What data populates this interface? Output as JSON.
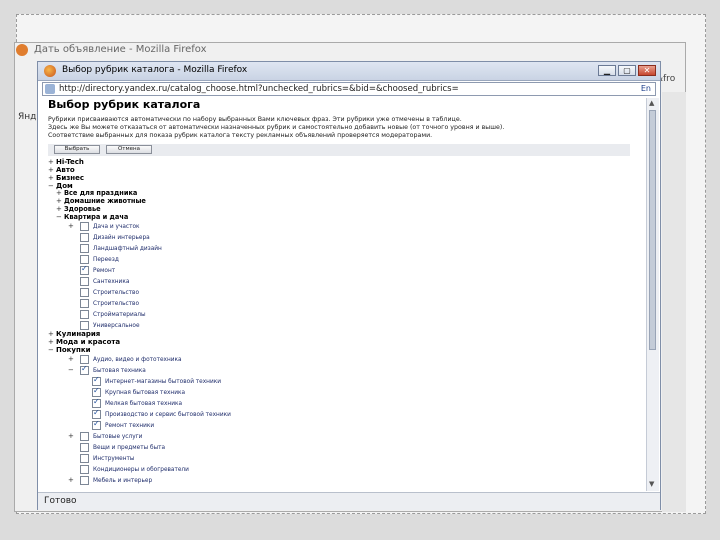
{
  "background_window": {
    "title": "Дать объявление - Mozilla Firefox",
    "right_text": "&fro",
    "left_glyphs": [
      "Янд"
    ]
  },
  "window": {
    "title": "Выбор рубрик каталога - Mozilla Firefox",
    "url": "http://directory.yandex.ru/catalog_choose.html?unchecked_rubrics=&bid=&choosed_rubrics=",
    "lang_indicator": "En",
    "status": "Готово"
  },
  "page": {
    "heading": "Выбор рубрик каталога",
    "intro_lines": [
      "Рубрики присваиваются автоматически по набору выбранных Вами ключевых фраз. Эти рубрики уже отмечены в таблице.",
      "Здесь же Вы можете отказаться от автоматически назначенных рубрик и самостоятельно добавить новые (от точного уровня и выше).",
      "Соответствие выбранных для показа рубрик каталога тексту рекламных объявлений проверяется модераторами."
    ],
    "buttons": {
      "choose": "Выбрать",
      "cancel": "Отмена"
    }
  },
  "tree": {
    "top1": [
      {
        "pm": "+",
        "label": "Hi-Tech"
      },
      {
        "pm": "+",
        "label": "Авто"
      },
      {
        "pm": "+",
        "label": "Бизнес"
      },
      {
        "pm": "−",
        "label": "Дом"
      }
    ],
    "dom_children": [
      {
        "pm": "+",
        "label": "Все для праздника"
      },
      {
        "pm": "+",
        "label": "Домашние животные"
      },
      {
        "pm": "+",
        "label": "Здоровье"
      },
      {
        "pm": "−",
        "label": "Квартира и дача"
      }
    ],
    "kvartira_children": [
      {
        "pm": "+",
        "label": "Дача и участок",
        "checked": false
      },
      {
        "pm": "",
        "label": "Дизайн интерьера",
        "checked": false
      },
      {
        "pm": "",
        "label": "Ландшафтный дизайн",
        "checked": false
      },
      {
        "pm": "",
        "label": "Переезд",
        "checked": false
      },
      {
        "pm": "",
        "label": "Ремонт",
        "checked": true
      },
      {
        "pm": "",
        "label": "Сантехника",
        "checked": false
      },
      {
        "pm": "",
        "label": "Строительство",
        "checked": false
      },
      {
        "pm": "",
        "label": "Строительство",
        "checked": false
      },
      {
        "pm": "",
        "label": "Стройматериалы",
        "checked": false
      },
      {
        "pm": "",
        "label": "Универсальное",
        "checked": false
      }
    ],
    "top2": [
      {
        "pm": "+",
        "label": "Кулинария"
      },
      {
        "pm": "+",
        "label": "Мода и красота"
      },
      {
        "pm": "−",
        "label": "Покупки"
      }
    ],
    "pokupki_children": [
      {
        "pm": "+",
        "label": "Аудио, видео и фототехника",
        "checked": false
      },
      {
        "pm": "−",
        "label": "Бытовая техника",
        "checked": true
      }
    ],
    "bytovaya_children": [
      {
        "label": "Интернет-магазины бытовой техники",
        "checked": true
      },
      {
        "label": "Крупная бытовая техника",
        "checked": true
      },
      {
        "label": "Мелкая бытовая техника",
        "checked": true
      },
      {
        "label": "Производство и сервис бытовой техники",
        "checked": true
      },
      {
        "label": "Ремонт техники",
        "checked": true
      }
    ],
    "pokupki_more": [
      {
        "pm": "+",
        "label": "Бытовые услуги",
        "checked": false
      },
      {
        "pm": "",
        "label": "Вещи и предметы быта",
        "checked": false
      },
      {
        "pm": "",
        "label": "Инструменты",
        "checked": false
      },
      {
        "pm": "",
        "label": "Кондиционеры и обогреватели",
        "checked": false
      },
      {
        "pm": "+",
        "label": "Мебель и интерьер",
        "checked": false
      }
    ]
  }
}
